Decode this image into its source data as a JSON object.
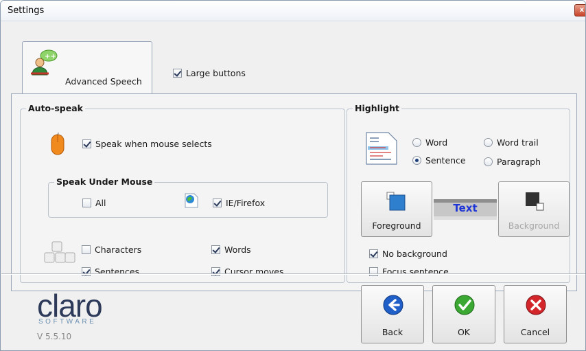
{
  "window": {
    "title": "Settings",
    "close": "x"
  },
  "tabs": {
    "active_label": "Advanced Speech",
    "large_buttons_label": "Large buttons",
    "large_buttons_checked": true
  },
  "auto_speak": {
    "title": "Auto-speak",
    "speak_when_mouse_selects": {
      "label": "Speak when mouse selects",
      "checked": true
    },
    "speak_under_mouse": {
      "title": "Speak Under Mouse",
      "all": {
        "label": "All",
        "checked": false
      },
      "ie_firefox": {
        "label": "IE/Firefox",
        "checked": true
      }
    },
    "characters": {
      "label": "Characters",
      "checked": false
    },
    "words": {
      "label": "Words",
      "checked": true
    },
    "sentences": {
      "label": "Sentences",
      "checked": true
    },
    "cursor_moves": {
      "label": "Cursor moves",
      "checked": true
    }
  },
  "highlight": {
    "title": "Highlight",
    "options": {
      "word": {
        "label": "Word",
        "selected": false
      },
      "word_trail": {
        "label": "Word trail",
        "selected": false
      },
      "sentence": {
        "label": "Sentence",
        "selected": true
      },
      "paragraph": {
        "label": "Paragraph",
        "selected": false
      }
    },
    "foreground_label": "Foreground",
    "background_label": "Background",
    "preview_text": "Text",
    "preview_text_color": "#1f35d6",
    "preview_bg_color": "#c7c7c7",
    "no_background": {
      "label": "No background",
      "checked": true
    },
    "focus_sentence": {
      "label": "Focus sentence",
      "checked": false
    }
  },
  "footer": {
    "logo": "claro",
    "logo_sub": "SOFTWARE",
    "version": "V 5.5.10",
    "back_label": "Back",
    "ok_label": "OK",
    "cancel_label": "Cancel"
  },
  "colors": {
    "back_icon": "#1f5fc7",
    "ok_icon": "#3aa832",
    "cancel_icon": "#d2262b"
  }
}
